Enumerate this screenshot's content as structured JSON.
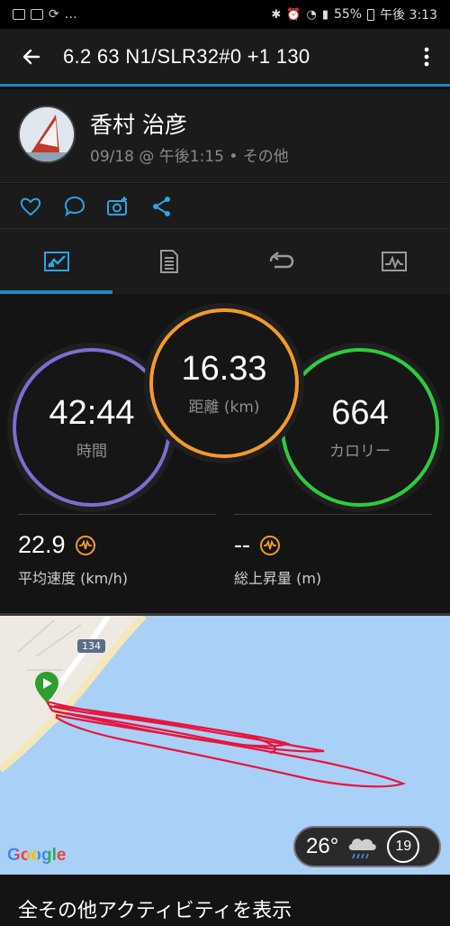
{
  "status_bar": {
    "battery": "55%",
    "time": "午後 3:13"
  },
  "app_bar": {
    "title": "6.2 63 N1/SLR32#0 +1 130"
  },
  "profile": {
    "name": "香村 治彦",
    "meta": "09/18 @ 午後1:15 • その他"
  },
  "tabs": [
    {
      "icon": "overview-icon",
      "active": true
    },
    {
      "icon": "details-icon",
      "active": false
    },
    {
      "icon": "laps-icon",
      "active": false
    },
    {
      "icon": "chart-icon",
      "active": false
    }
  ],
  "stats": {
    "time": {
      "value": "42:44",
      "label": "時間",
      "color": "#7a6fd0"
    },
    "distance": {
      "value": "16.33",
      "label": "距離 (km)",
      "color": "#f29b2b"
    },
    "calories": {
      "value": "664",
      "label": "カロリー",
      "color": "#2ecc40"
    },
    "avg_speed": {
      "value": "22.9",
      "label": "平均速度 (km/h)"
    },
    "elevation": {
      "value": "--",
      "label": "総上昇量 (m)"
    }
  },
  "map": {
    "road_label": "134",
    "provider": "Google",
    "weather_temp": "26°",
    "wind_speed": "19",
    "track_color": "#e8143c"
  },
  "footer": {
    "label": "全その他アクティビティを表示"
  }
}
